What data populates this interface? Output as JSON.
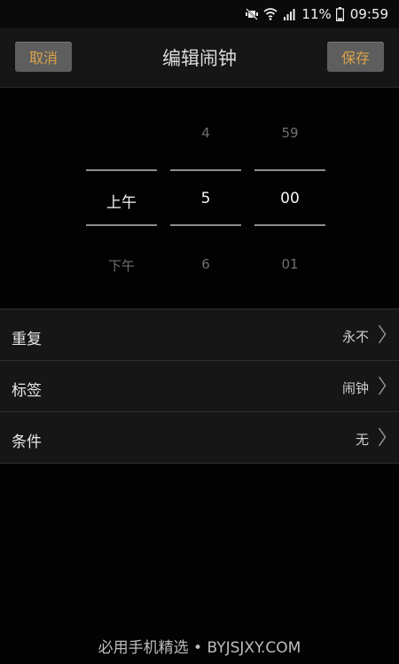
{
  "status": {
    "battery": "11%",
    "time": "09:59",
    "icons": [
      "mute-vibrate-icon",
      "wifi-icon",
      "signal-icon",
      "battery-icon"
    ]
  },
  "header": {
    "cancel_label": "取消",
    "title": "编辑闹钟",
    "save_label": "保存"
  },
  "picker": {
    "period": {
      "prev": "",
      "selected": "上午",
      "next": "下午"
    },
    "hour": {
      "prev": "4",
      "selected": "5",
      "next": "6"
    },
    "minute": {
      "prev": "59",
      "selected": "00",
      "next": "01"
    }
  },
  "settings": [
    {
      "label": "重复",
      "value": "永不"
    },
    {
      "label": "标签",
      "value": "闹钟"
    },
    {
      "label": "条件",
      "value": "无"
    }
  ],
  "watermark": "必用手机精选 • BYJSJXY.COM",
  "colors": {
    "accent": "#d9a24a",
    "background": "#030303",
    "panel": "#161616"
  }
}
